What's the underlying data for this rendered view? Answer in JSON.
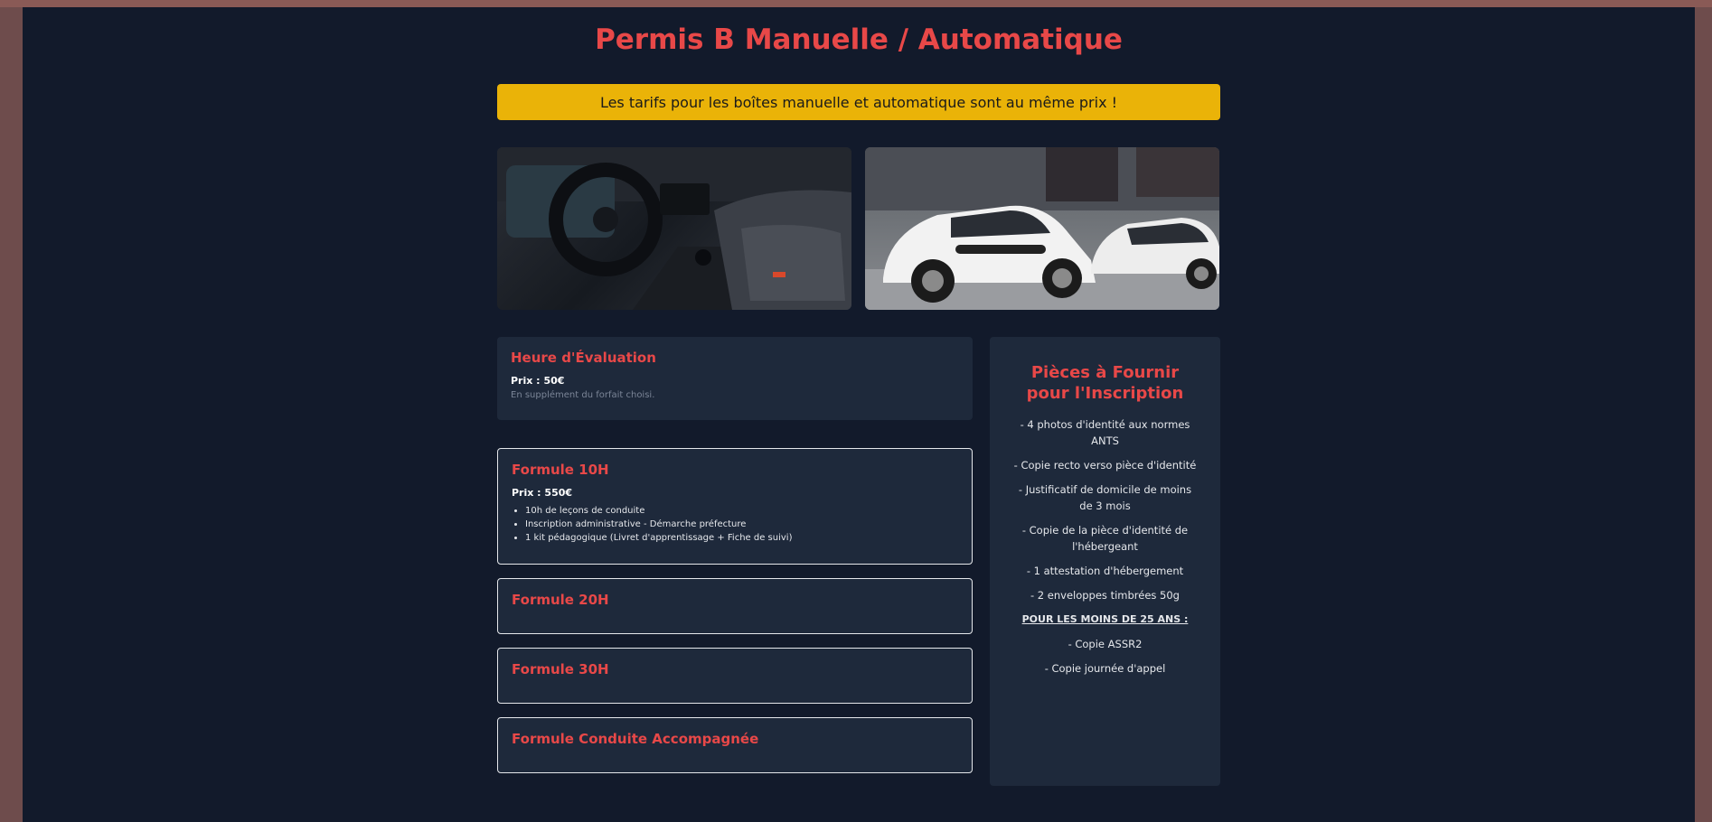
{
  "header": {
    "title": "Permis B Manuelle / Automatique",
    "banner": "Les tarifs pour les boîtes manuelle et automatique sont au même prix !"
  },
  "photos": [
    {
      "name": "car-interior-photo"
    },
    {
      "name": "driving-school-cars-photo"
    }
  ],
  "evaluation": {
    "title": "Heure d'Évaluation",
    "price_label": "Prix :",
    "price": "50€",
    "note": "En supplément du forfait choisi."
  },
  "formulas": [
    {
      "title": "Formule 10H",
      "price_label": "Prix : 550€",
      "features": [
        "10h de leçons de conduite",
        "Inscription administrative - Démarche préfecture",
        "1 kit pédagogique (Livret d'apprentissage + Fiche de suivi)"
      ]
    },
    {
      "title": "Formule 20H"
    },
    {
      "title": "Formule 30H"
    },
    {
      "title": "Formule Conduite Accompagnée"
    }
  ],
  "documents": {
    "title_line1": "Pièces à Fournir",
    "title_line2": "pour l'Inscription",
    "items": [
      "- 4 photos d'identité aux normes ANTS",
      "- Copie recto verso pièce d'identité",
      "- Justificatif de domicile de moins de 3 mois",
      "- Copie de la pièce d'identité de l'hébergeant",
      "- 1 attestation d'hébergement",
      "- 2 enveloppes timbrées 50g"
    ],
    "under25_heading": "POUR LES MOINS DE 25 ANS :",
    "under25_items": [
      "- Copie ASSR2",
      "- Copie journée d'appel"
    ]
  },
  "colors": {
    "accent": "#e84848",
    "banner": "#eab308",
    "background": "#121a2b",
    "card": "#1e293b"
  }
}
